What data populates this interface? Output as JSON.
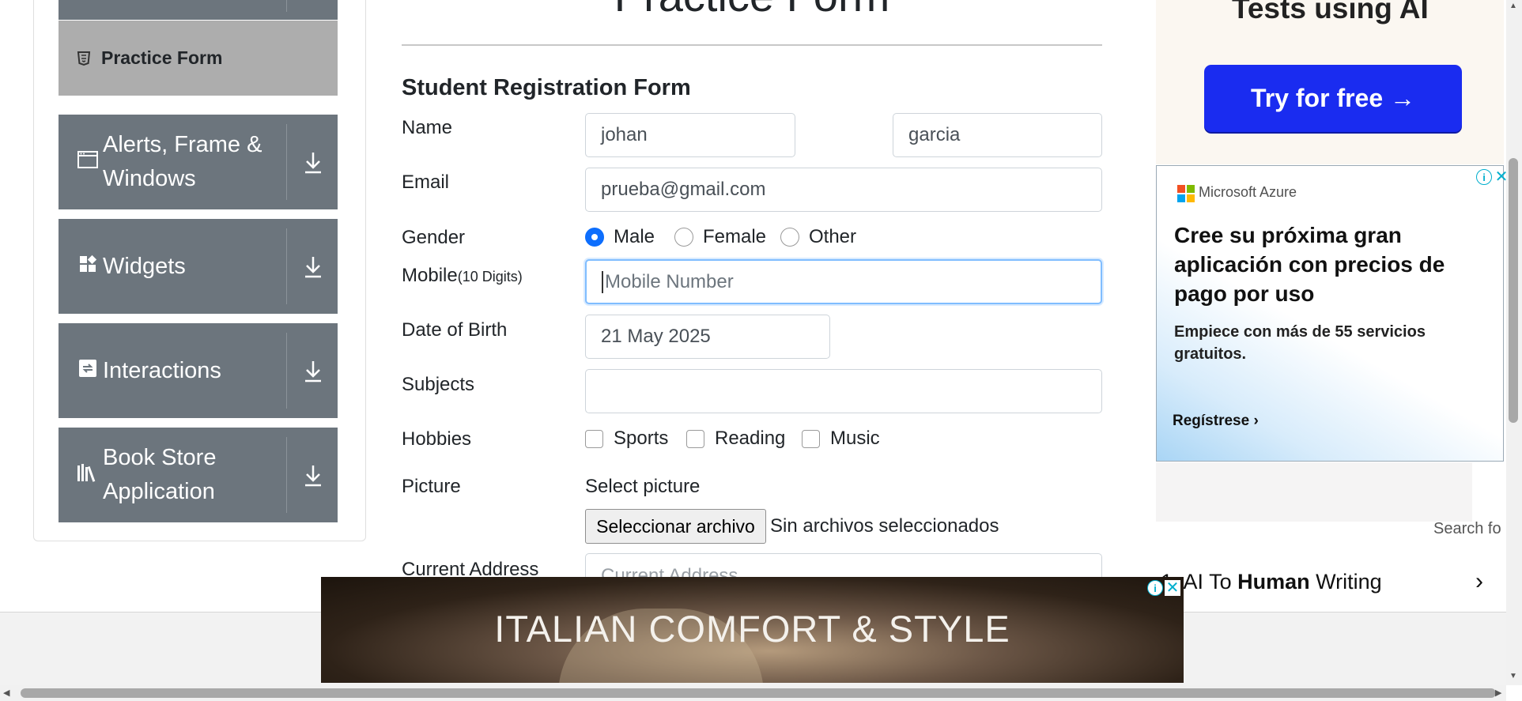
{
  "sidebar": {
    "practice_form_label": "Practice Form",
    "groups": [
      {
        "label": "Alerts, Frame & Windows",
        "icon": "window-icon"
      },
      {
        "label": "Widgets",
        "icon": "widgets-icon"
      },
      {
        "label": "Interactions",
        "icon": "interactions-icon"
      },
      {
        "label": "Book Store Application",
        "icon": "books-icon"
      }
    ]
  },
  "page": {
    "heading": "Practice Form",
    "subheading": "Student Registration Form"
  },
  "form": {
    "name_label": "Name",
    "first_name": "johan",
    "last_name": "garcia",
    "email_label": "Email",
    "email_value": "prueba@gmail.com",
    "gender_label": "Gender",
    "gender_options": [
      "Male",
      "Female",
      "Other"
    ],
    "gender_selected": "Male",
    "mobile_label": "Mobile",
    "mobile_hint": "(10 Digits)",
    "mobile_placeholder": "Mobile Number",
    "dob_label": "Date of Birth",
    "dob_value": "21 May 2025",
    "subjects_label": "Subjects",
    "subjects_value": "",
    "hobbies_label": "Hobbies",
    "hobbies": [
      "Sports",
      "Reading",
      "Music"
    ],
    "picture_label": "Picture",
    "select_picture": "Select picture",
    "file_button": "Seleccionar archivo",
    "file_status": "Sin archivos seleccionados",
    "address_label": "Current Address",
    "address_placeholder": "Current Address"
  },
  "ads": {
    "top_title": "Tests using AI",
    "top_button": "Try for free →",
    "azure_brand": "Microsoft Azure",
    "azure_headline": "Cree su próxima gran aplicación con precios de pago por uso",
    "azure_sub": "Empiece con más de 55 servicios gratuitos.",
    "azure_cta": "Regístrese",
    "search_for": "Search fo",
    "ai_item_prefix": "AI To",
    "ai_item_bold": "Human",
    "ai_item_suffix": "Writing",
    "banner_text": "ITALIAN COMFORT & STYLE"
  },
  "colors": {
    "sidebar_group_bg": "#6c757d",
    "sidebar_active_bg": "#adadad",
    "radio_checked": "#0d6efd",
    "focus_border": "#80bdff",
    "try_button_bg": "#1a2cf0",
    "ad_info_color": "#00aecd"
  }
}
